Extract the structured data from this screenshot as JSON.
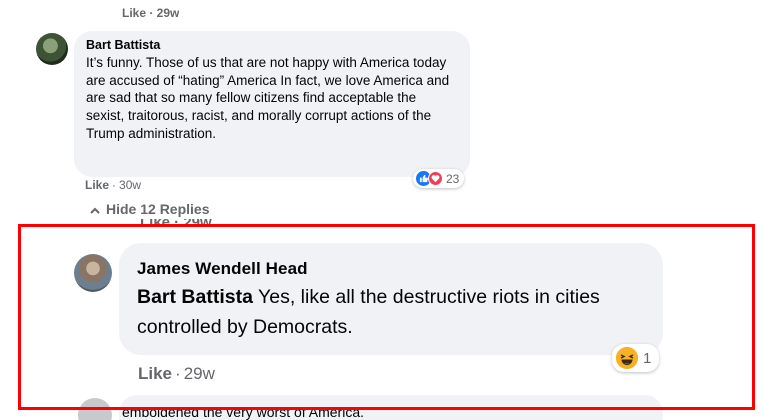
{
  "top_cut": {
    "text": "Like · 29w"
  },
  "comment1": {
    "author": "Bart Battista",
    "text": "It’s funny. Those of us that are not happy with America today are accused of “hating” America In fact, we love America and are sad that so many fellow citizens find acceptable the sexist, traitorous, racist, and morally corrupt actions of the Trump administration.",
    "like_label": "Like",
    "time": "30w",
    "reaction_count": "23",
    "reaction_icons": [
      "like-icon",
      "love-icon"
    ]
  },
  "hide_replies": {
    "label": "Hide 12 Replies",
    "icon": "chevron-up-icon"
  },
  "mid_cut": {
    "text": "Like · 29w"
  },
  "reply": {
    "author": "James Wendell Head",
    "mention": "Bart Battista",
    "text": " Yes, like all the destructive riots in cities controlled by Democrats.",
    "like_label": "Like",
    "time": "29w",
    "reaction_count": "1",
    "reaction_icons": [
      "haha-icon"
    ]
  },
  "bottom_cut": {
    "text": "emboldened the very worst of America."
  },
  "colors": {
    "highlight": "#ff0000",
    "bubble": "#f0f2f5",
    "meta": "#65676b",
    "like": "#1877f2",
    "love": "#f33e58",
    "haha": "#f7b125"
  }
}
